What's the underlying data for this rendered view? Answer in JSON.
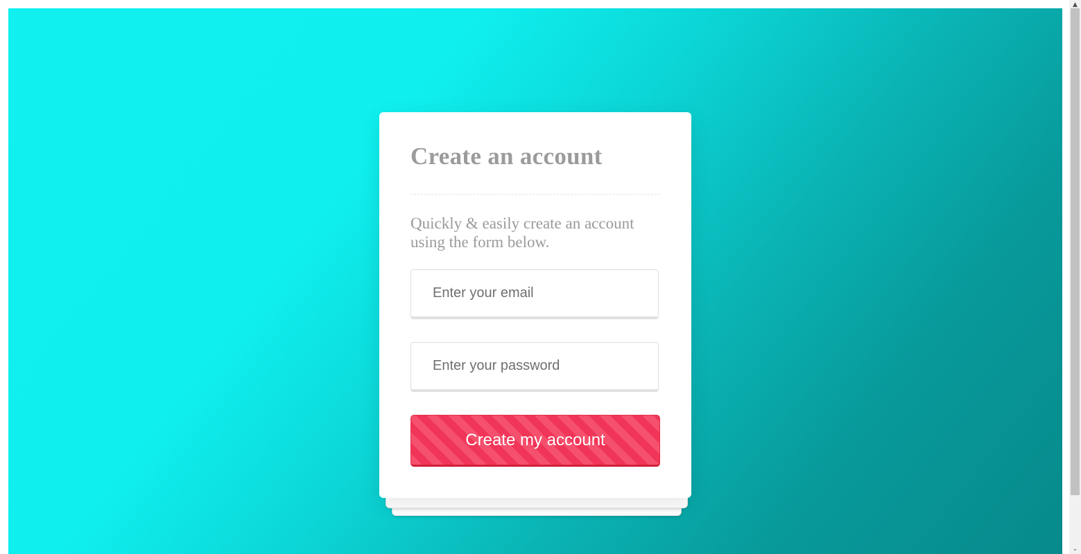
{
  "signup": {
    "title": "Create an account",
    "subtitle": "Quickly & easily create an account using the form below.",
    "email_placeholder": "Enter your email",
    "password_placeholder": "Enter your password",
    "submit_label": "Create my account"
  },
  "scrollbar": {
    "up_arrow_icon": "triangle-up",
    "down_arrow_icon": "chevron-down"
  },
  "colors": {
    "background_start": "#10f1ef",
    "background_end": "#078a8b",
    "button_primary": "#f23a5a",
    "button_stripe": "#f5506d",
    "title_text": "#9b9b9b"
  }
}
